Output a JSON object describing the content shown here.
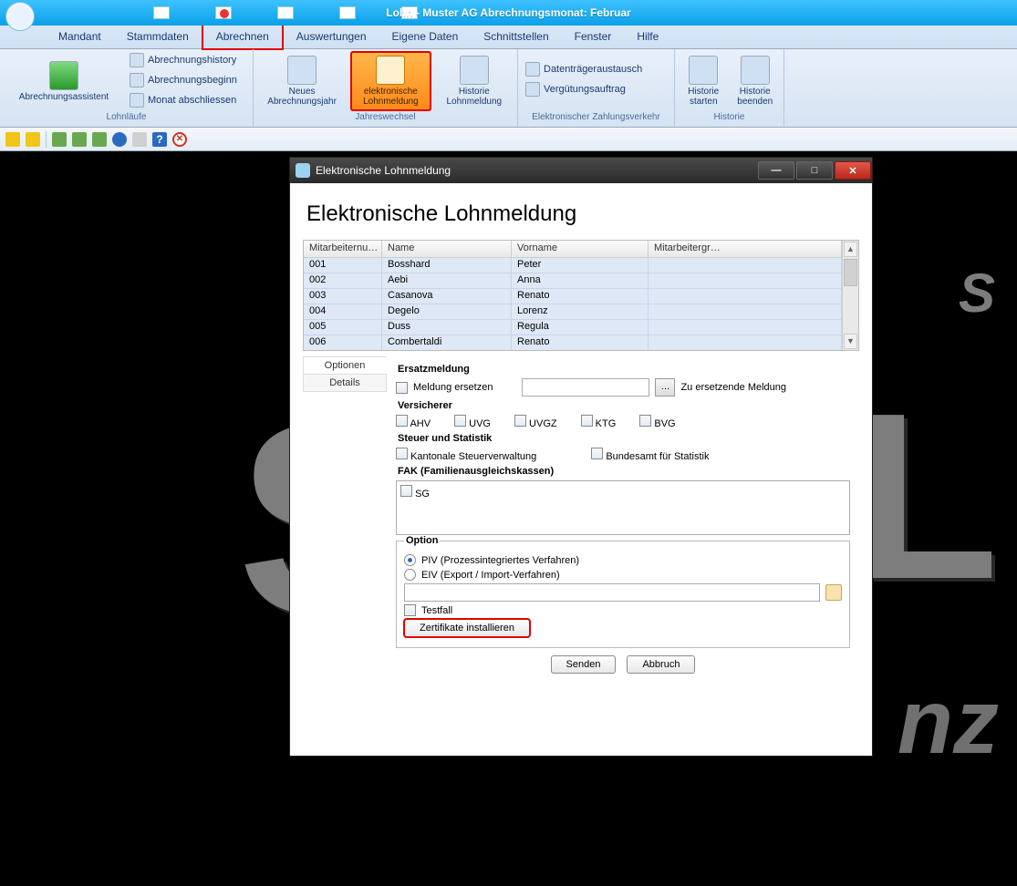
{
  "titlebar": {
    "title": "Lohn - Muster AG   Abrechnungsmonat: Februar"
  },
  "menu": [
    "Mandant",
    "Stammdaten",
    "Abrechnen",
    "Auswertungen",
    "Eigene Daten",
    "Schnittstellen",
    "Fenster",
    "Hilfe"
  ],
  "menu_active_index": 2,
  "ribbon": {
    "groups": [
      {
        "label": "Lohnläufe",
        "big": [
          {
            "label": "Abrechnungsassistent"
          }
        ],
        "small": [
          "Abrechnungshistory",
          "Abrechnungsbeginn",
          "Monat abschliessen"
        ]
      },
      {
        "label": "Jahreswechsel",
        "big": [
          {
            "label": "Neues\nAbrechnungsjahr"
          },
          {
            "label": "elektronische\nLohnmeldung",
            "highlight": true
          },
          {
            "label": "Historie\nLohnmeldung"
          }
        ]
      },
      {
        "label": "Elektronischer Zahlungsverkehr",
        "small": [
          "Datenträgeraustausch",
          "Vergütungsauftrag"
        ]
      },
      {
        "label": "Historie",
        "big": [
          {
            "label": "Historie\nstarten"
          },
          {
            "label": "Historie\nbeenden"
          }
        ]
      }
    ]
  },
  "dialog": {
    "title": "Elektronische Lohnmeldung",
    "heading": "Elektronische Lohnmeldung",
    "columns": [
      "Mitarbeiternu…",
      "Name",
      "Vorname",
      "Mitarbeitergr…"
    ],
    "rows": [
      {
        "nr": "001",
        "name": "Bosshard",
        "vor": "Peter",
        "grp": ""
      },
      {
        "nr": "002",
        "name": "Aebi",
        "vor": "Anna",
        "grp": ""
      },
      {
        "nr": "003",
        "name": "Casanova",
        "vor": "Renato",
        "grp": ""
      },
      {
        "nr": "004",
        "name": "Degelo",
        "vor": "Lorenz",
        "grp": ""
      },
      {
        "nr": "005",
        "name": "Duss",
        "vor": "Regula",
        "grp": ""
      },
      {
        "nr": "006",
        "name": "Combertaldi",
        "vor": "Renato",
        "grp": ""
      }
    ],
    "tabs": [
      "Optionen",
      "Details"
    ],
    "ersatz": {
      "title": "Ersatzmeldung",
      "chk": "Meldung ersetzen",
      "hint": "Zu ersetzende Meldung"
    },
    "versicherer": {
      "title": "Versicherer",
      "items": [
        "AHV",
        "UVG",
        "UVGZ",
        "KTG",
        "BVG"
      ]
    },
    "steuer": {
      "title": "Steuer und Statistik",
      "a": "Kantonale Steuerverwaltung",
      "b": "Bundesamt für Statistik"
    },
    "fak": {
      "title": "FAK (Familienausgleichskassen)",
      "item": "SG"
    },
    "option": {
      "title": "Option",
      "piv": "PIV (Prozessintegriertes Verfahren)",
      "eiv": "EIV (Export / Import-Verfahren)",
      "testfall": "Testfall",
      "cert": "Zertifikate installieren"
    },
    "buttons": {
      "send": "Senden",
      "cancel": "Abbruch"
    }
  }
}
